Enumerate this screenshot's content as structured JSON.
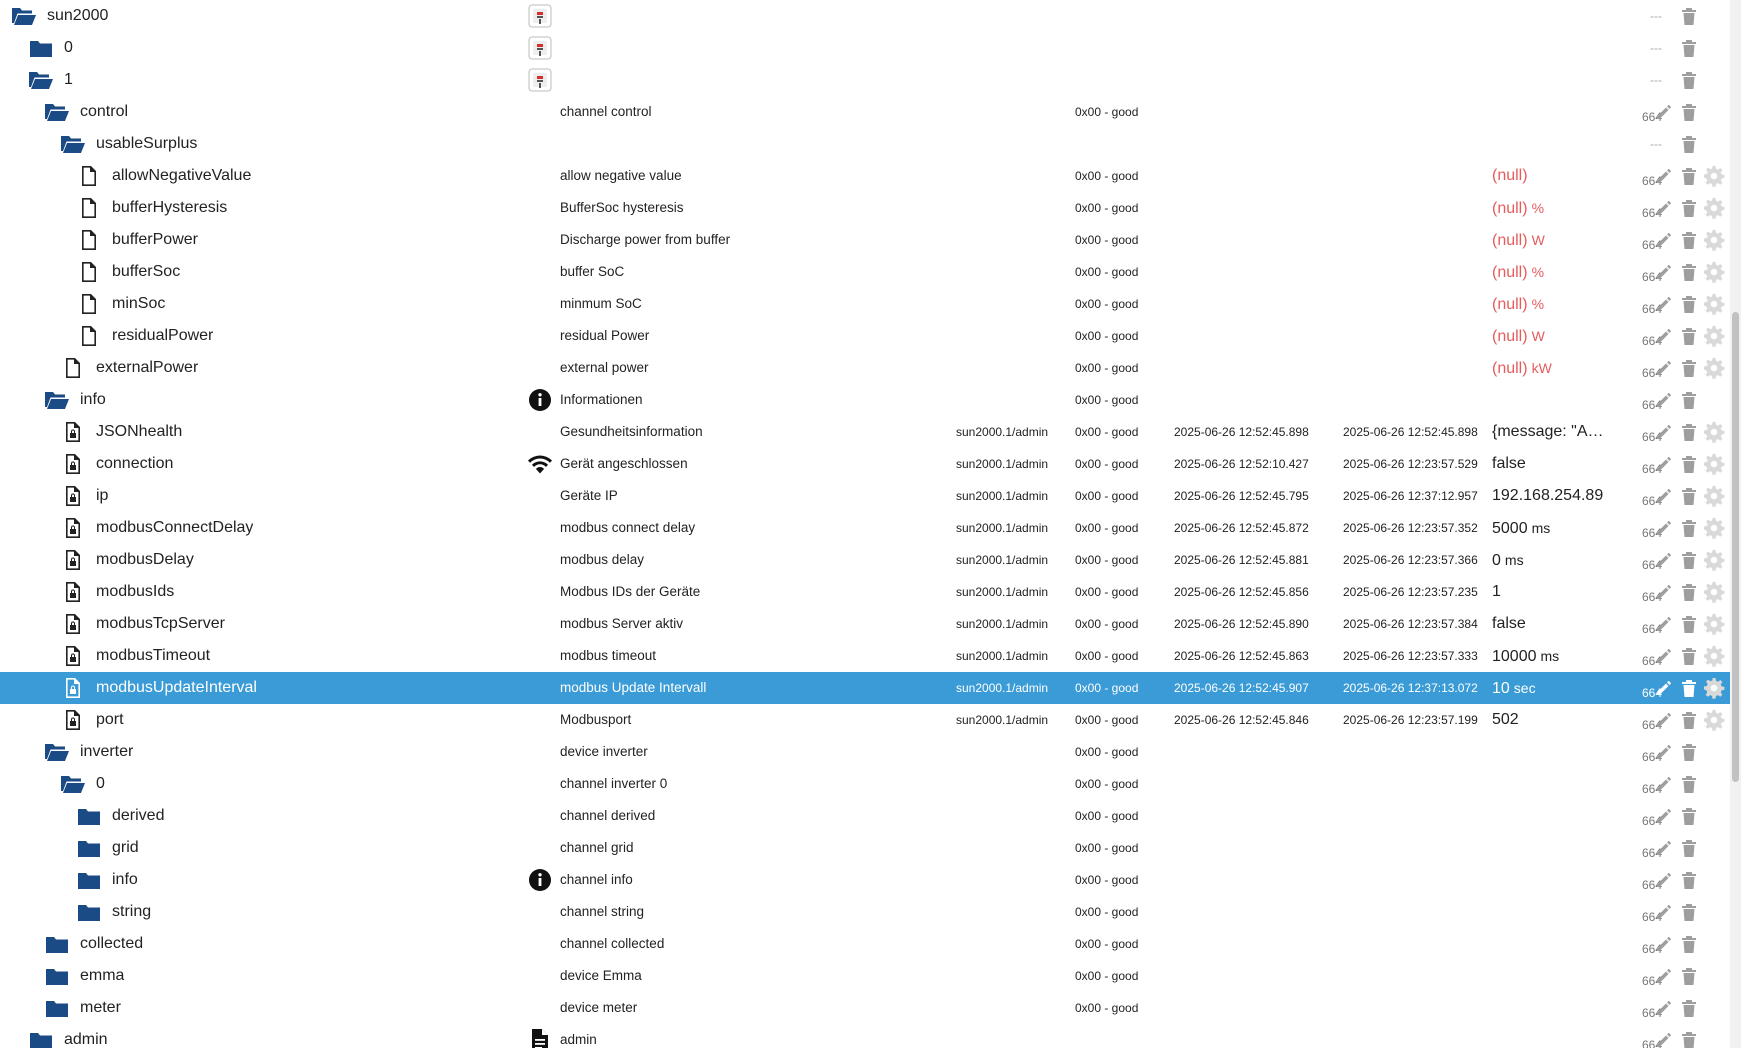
{
  "rows": [
    {
      "label": "sun2000",
      "depth": 0,
      "icon": "folder-open-icon",
      "role_icon": "adapter-icon",
      "name": "",
      "from": "",
      "quality": "",
      "ts": "",
      "lc": "",
      "value": "",
      "unit": "",
      "rights": "---",
      "edit": false,
      "gear": false
    },
    {
      "label": "0",
      "depth": 1,
      "icon": "folder-icon",
      "role_icon": "adapter-icon",
      "name": "",
      "from": "",
      "quality": "",
      "ts": "",
      "lc": "",
      "value": "",
      "unit": "",
      "rights": "---",
      "edit": false,
      "gear": false
    },
    {
      "label": "1",
      "depth": 1,
      "icon": "folder-open-icon",
      "role_icon": "adapter-icon",
      "name": "",
      "from": "",
      "quality": "",
      "ts": "",
      "lc": "",
      "value": "",
      "unit": "",
      "rights": "---",
      "edit": false,
      "gear": false
    },
    {
      "label": "control",
      "depth": 2,
      "icon": "folder-open-icon",
      "role_icon": "",
      "name": "channel control",
      "from": "",
      "quality": "0x00 - good",
      "ts": "",
      "lc": "",
      "value": "",
      "unit": "",
      "rights": "664",
      "edit": true,
      "gear": false
    },
    {
      "label": "usableSurplus",
      "depth": 3,
      "icon": "folder-open-icon",
      "role_icon": "",
      "name": "",
      "from": "",
      "quality": "",
      "ts": "",
      "lc": "",
      "value": "",
      "unit": "",
      "rights": "---",
      "edit": false,
      "gear": false
    },
    {
      "label": "allowNegativeValue",
      "depth": 4,
      "icon": "file-icon",
      "role_icon": "",
      "name": "allow negative value",
      "from": "",
      "quality": "0x00 - good",
      "ts": "",
      "lc": "",
      "value": "(null)",
      "unit": "",
      "rights": "664",
      "edit": true,
      "gear": true,
      "null": true
    },
    {
      "label": "bufferHysteresis",
      "depth": 4,
      "icon": "file-icon",
      "role_icon": "",
      "name": "BufferSoc hysteresis",
      "from": "",
      "quality": "0x00 - good",
      "ts": "",
      "lc": "",
      "value": "(null)",
      "unit": "%",
      "rights": "664",
      "edit": true,
      "gear": true,
      "null": true
    },
    {
      "label": "bufferPower",
      "depth": 4,
      "icon": "file-icon",
      "role_icon": "",
      "name": "Discharge power from buffer",
      "from": "",
      "quality": "0x00 - good",
      "ts": "",
      "lc": "",
      "value": "(null)",
      "unit": "W",
      "rights": "664",
      "edit": true,
      "gear": true,
      "null": true
    },
    {
      "label": "bufferSoc",
      "depth": 4,
      "icon": "file-icon",
      "role_icon": "",
      "name": "buffer SoC",
      "from": "",
      "quality": "0x00 - good",
      "ts": "",
      "lc": "",
      "value": "(null)",
      "unit": "%",
      "rights": "664",
      "edit": true,
      "gear": true,
      "null": true
    },
    {
      "label": "minSoc",
      "depth": 4,
      "icon": "file-icon",
      "role_icon": "",
      "name": "minmum SoC",
      "from": "",
      "quality": "0x00 - good",
      "ts": "",
      "lc": "",
      "value": "(null)",
      "unit": "%",
      "rights": "664",
      "edit": true,
      "gear": true,
      "null": true
    },
    {
      "label": "residualPower",
      "depth": 4,
      "icon": "file-icon",
      "role_icon": "",
      "name": "residual Power",
      "from": "",
      "quality": "0x00 - good",
      "ts": "",
      "lc": "",
      "value": "(null)",
      "unit": "W",
      "rights": "664",
      "edit": true,
      "gear": true,
      "null": true
    },
    {
      "label": "externalPower",
      "depth": 3,
      "icon": "file-icon",
      "role_icon": "",
      "name": "external power",
      "from": "",
      "quality": "0x00 - good",
      "ts": "",
      "lc": "",
      "value": "(null)",
      "unit": "kW",
      "rights": "664",
      "edit": true,
      "gear": true,
      "null": true
    },
    {
      "label": "info",
      "depth": 2,
      "icon": "folder-open-icon",
      "role_icon": "info-icon",
      "name": "Informationen",
      "from": "",
      "quality": "0x00 - good",
      "ts": "",
      "lc": "",
      "value": "",
      "unit": "",
      "rights": "664",
      "edit": true,
      "gear": false
    },
    {
      "label": "JSONhealth",
      "depth": 3,
      "icon": "file-lock-icon",
      "role_icon": "",
      "name": "Gesundheitsinformation",
      "from": "sun2000.1/admin",
      "quality": "0x00 - good",
      "ts": "2025-06-26 12:52:45.898",
      "lc": "2025-06-26 12:52:45.898",
      "value": "{message: \"Adj...",
      "unit": "",
      "rights": "664",
      "edit": true,
      "gear": true
    },
    {
      "label": "connection",
      "depth": 3,
      "icon": "file-lock-icon",
      "role_icon": "wifi-icon",
      "name": "Gerät angeschlossen",
      "from": "sun2000.1/admin",
      "quality": "0x00 - good",
      "ts": "2025-06-26 12:52:10.427",
      "lc": "2025-06-26 12:23:57.529",
      "value": "false",
      "unit": "",
      "rights": "664",
      "edit": true,
      "gear": true
    },
    {
      "label": "ip",
      "depth": 3,
      "icon": "file-lock-icon",
      "role_icon": "",
      "name": "Geräte IP",
      "from": "sun2000.1/admin",
      "quality": "0x00 - good",
      "ts": "2025-06-26 12:52:45.795",
      "lc": "2025-06-26 12:37:12.957",
      "value": "192.168.254.89",
      "unit": "",
      "rights": "664",
      "edit": true,
      "gear": true
    },
    {
      "label": "modbusConnectDelay",
      "depth": 3,
      "icon": "file-lock-icon",
      "role_icon": "",
      "name": "modbus connect delay",
      "from": "sun2000.1/admin",
      "quality": "0x00 - good",
      "ts": "2025-06-26 12:52:45.872",
      "lc": "2025-06-26 12:23:57.352",
      "value": "5000",
      "unit": "ms",
      "rights": "664",
      "edit": true,
      "gear": true
    },
    {
      "label": "modbusDelay",
      "depth": 3,
      "icon": "file-lock-icon",
      "role_icon": "",
      "name": "modbus delay",
      "from": "sun2000.1/admin",
      "quality": "0x00 - good",
      "ts": "2025-06-26 12:52:45.881",
      "lc": "2025-06-26 12:23:57.366",
      "value": "0",
      "unit": "ms",
      "rights": "664",
      "edit": true,
      "gear": true
    },
    {
      "label": "modbusIds",
      "depth": 3,
      "icon": "file-lock-icon",
      "role_icon": "",
      "name": "Modbus IDs der Geräte",
      "from": "sun2000.1/admin",
      "quality": "0x00 - good",
      "ts": "2025-06-26 12:52:45.856",
      "lc": "2025-06-26 12:23:57.235",
      "value": "1",
      "unit": "",
      "rights": "664",
      "edit": true,
      "gear": true
    },
    {
      "label": "modbusTcpServer",
      "depth": 3,
      "icon": "file-lock-icon",
      "role_icon": "",
      "name": "modbus Server aktiv",
      "from": "sun2000.1/admin",
      "quality": "0x00 - good",
      "ts": "2025-06-26 12:52:45.890",
      "lc": "2025-06-26 12:23:57.384",
      "value": "false",
      "unit": "",
      "rights": "664",
      "edit": true,
      "gear": true
    },
    {
      "label": "modbusTimeout",
      "depth": 3,
      "icon": "file-lock-icon",
      "role_icon": "",
      "name": "modbus timeout",
      "from": "sun2000.1/admin",
      "quality": "0x00 - good",
      "ts": "2025-06-26 12:52:45.863",
      "lc": "2025-06-26 12:23:57.333",
      "value": "10000",
      "unit": "ms",
      "rights": "664",
      "edit": true,
      "gear": true
    },
    {
      "label": "modbusUpdateInterval",
      "depth": 3,
      "icon": "file-lock-icon",
      "role_icon": "",
      "name": "modbus Update Intervall",
      "from": "sun2000.1/admin",
      "quality": "0x00 - good",
      "ts": "2025-06-26 12:52:45.907",
      "lc": "2025-06-26 12:37:13.072",
      "value": "10",
      "unit": "sec",
      "rights": "664",
      "edit": true,
      "gear": true,
      "selected": true
    },
    {
      "label": "port",
      "depth": 3,
      "icon": "file-lock-icon",
      "role_icon": "",
      "name": "Modbusport",
      "from": "sun2000.1/admin",
      "quality": "0x00 - good",
      "ts": "2025-06-26 12:52:45.846",
      "lc": "2025-06-26 12:23:57.199",
      "value": "502",
      "unit": "",
      "rights": "664",
      "edit": true,
      "gear": true
    },
    {
      "label": "inverter",
      "depth": 2,
      "icon": "folder-open-icon",
      "role_icon": "",
      "name": "device inverter",
      "from": "",
      "quality": "0x00 - good",
      "ts": "",
      "lc": "",
      "value": "",
      "unit": "",
      "rights": "664",
      "edit": true,
      "gear": false
    },
    {
      "label": "0",
      "depth": 3,
      "icon": "folder-open-icon",
      "role_icon": "",
      "name": "channel inverter 0",
      "from": "",
      "quality": "0x00 - good",
      "ts": "",
      "lc": "",
      "value": "",
      "unit": "",
      "rights": "664",
      "edit": true,
      "gear": false
    },
    {
      "label": "derived",
      "depth": 4,
      "icon": "folder-icon",
      "role_icon": "",
      "name": "channel derived",
      "from": "",
      "quality": "0x00 - good",
      "ts": "",
      "lc": "",
      "value": "",
      "unit": "",
      "rights": "664",
      "edit": true,
      "gear": false
    },
    {
      "label": "grid",
      "depth": 4,
      "icon": "folder-icon",
      "role_icon": "",
      "name": "channel grid",
      "from": "",
      "quality": "0x00 - good",
      "ts": "",
      "lc": "",
      "value": "",
      "unit": "",
      "rights": "664",
      "edit": true,
      "gear": false
    },
    {
      "label": "info",
      "depth": 4,
      "icon": "folder-icon",
      "role_icon": "info-icon",
      "name": "channel info",
      "from": "",
      "quality": "0x00 - good",
      "ts": "",
      "lc": "",
      "value": "",
      "unit": "",
      "rights": "664",
      "edit": true,
      "gear": false
    },
    {
      "label": "string",
      "depth": 4,
      "icon": "folder-icon",
      "role_icon": "",
      "name": "channel string",
      "from": "",
      "quality": "0x00 - good",
      "ts": "",
      "lc": "",
      "value": "",
      "unit": "",
      "rights": "664",
      "edit": true,
      "gear": false
    },
    {
      "label": "collected",
      "depth": 2,
      "icon": "folder-icon",
      "role_icon": "",
      "name": "channel collected",
      "from": "",
      "quality": "0x00 - good",
      "ts": "",
      "lc": "",
      "value": "",
      "unit": "",
      "rights": "664",
      "edit": true,
      "gear": false
    },
    {
      "label": "emma",
      "depth": 2,
      "icon": "folder-icon",
      "role_icon": "",
      "name": "device Emma",
      "from": "",
      "quality": "0x00 - good",
      "ts": "",
      "lc": "",
      "value": "",
      "unit": "",
      "rights": "664",
      "edit": true,
      "gear": false
    },
    {
      "label": "meter",
      "depth": 2,
      "icon": "folder-icon",
      "role_icon": "",
      "name": "device meter",
      "from": "",
      "quality": "0x00 - good",
      "ts": "",
      "lc": "",
      "value": "",
      "unit": "",
      "rights": "664",
      "edit": true,
      "gear": false
    },
    {
      "label": "admin",
      "depth": 1,
      "icon": "folder-icon",
      "role_icon": "document-icon",
      "name": "admin",
      "from": "",
      "quality": "",
      "ts": "",
      "lc": "",
      "value": "",
      "unit": "",
      "rights": "664",
      "edit": true,
      "gear": false
    }
  ],
  "colors": {
    "folder": "#1b4b84",
    "selected": "#3a9bd6",
    "null_value": "#e55c5c",
    "action": "#9e9e9e"
  }
}
